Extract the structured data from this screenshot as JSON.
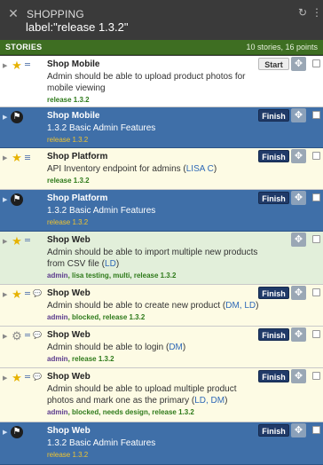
{
  "header": {
    "close_icon": "close-icon",
    "title": "SHOPPING",
    "query": "label:\"release 1.3.2\"",
    "refresh_icon": "refresh-icon",
    "more_icon": "more-vertical-icon"
  },
  "section": {
    "label": "STORIES",
    "count": "10 stories, 16 points"
  },
  "colors": {
    "header_bg": "#3a3a3a",
    "section_bg": "#3e6e22",
    "release_bg": "#3f6fa8",
    "feature_bg": "#ffffff",
    "chore_bg": "#fdfbe4",
    "accepted_bg": "#e2efda",
    "finish_button": "#203a68",
    "label_green": "#2e7a1a",
    "label_release_yellow": "#f0c430"
  },
  "stories": [
    {
      "kind": "feature",
      "type_icon": "star-icon",
      "project": "Shop Mobile",
      "title": "Admin should be able to upload product photos for mobile viewing",
      "labels": [
        "release 1.3.2"
      ],
      "button": "Start"
    },
    {
      "kind": "release",
      "type_icon": "release-flag-icon",
      "project": "Shop Mobile",
      "title": "1.3.2 Basic Admin Features",
      "labels": [
        "release 1.3.2"
      ],
      "button": "Finish"
    },
    {
      "kind": "chore",
      "type_icon": "star-icon",
      "project": "Shop Platform",
      "title": "API Inventory endpoint for admins (",
      "initials": "LISA C",
      "title_end": ")",
      "labels": [
        "release 1.3.2"
      ],
      "button": "Finish"
    },
    {
      "kind": "release",
      "type_icon": "release-flag-icon",
      "project": "Shop Platform",
      "title": "1.3.2 Basic Admin Features",
      "labels": [
        "release 1.3.2"
      ],
      "button": "Finish"
    },
    {
      "kind": "accepted",
      "type_icon": "star-icon",
      "project": "Shop Web",
      "title": "Admin should be able to import multiple new products from CSV file (",
      "initials": "LD",
      "title_end": ")",
      "labels": [
        "admin",
        "lisa testing",
        "multi",
        "release 1.3.2"
      ],
      "button": ""
    },
    {
      "kind": "chore",
      "type_icon": "star-icon",
      "project": "Shop Web",
      "title": "Admin should be able to create new product (",
      "initials": "DM, LD",
      "title_end": ")",
      "labels": [
        "admin",
        "blocked",
        "release 1.3.2"
      ],
      "button": "Finish"
    },
    {
      "kind": "chore",
      "type_icon": "gear-icon",
      "project": "Shop Web",
      "title": "Admin should be able to login (",
      "initials": "DM",
      "title_end": ")",
      "labels": [
        "admin",
        "release 1.3.2"
      ],
      "button": "Finish"
    },
    {
      "kind": "chore",
      "type_icon": "star-icon",
      "project": "Shop Web",
      "title": "Admin should be able to upload multiple product photos and mark one as the primary (",
      "initials": "LD, DM",
      "title_end": ")",
      "labels": [
        "admin",
        "blocked",
        "needs design",
        "release 1.3.2"
      ],
      "button": "Finish"
    },
    {
      "kind": "release",
      "type_icon": "release-flag-icon",
      "project": "Shop Web",
      "title": "1.3.2 Basic Admin Features",
      "labels": [
        "release 1.3.2"
      ],
      "button": "Finish"
    }
  ]
}
